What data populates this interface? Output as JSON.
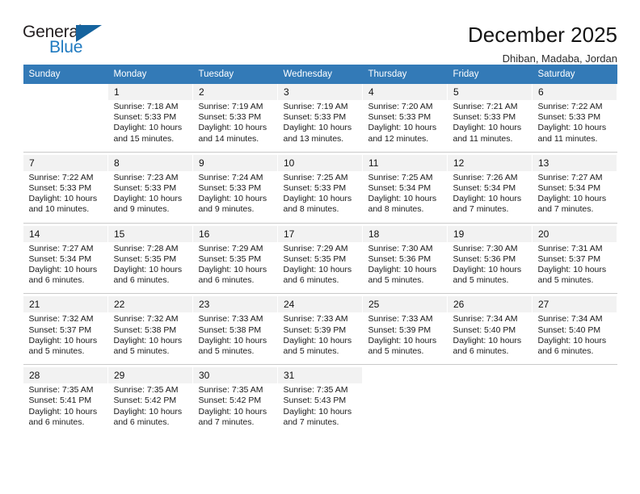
{
  "brand": {
    "name_top": "General",
    "name_bottom": "Blue",
    "accent_color": "#1f7ac0",
    "triangle_color": "#15639e"
  },
  "header": {
    "title": "December 2025",
    "location": "Dhiban, Madaba, Jordan"
  },
  "calendar": {
    "header_color": "#337ab7",
    "daynum_background": "#f2f2f2",
    "weekdays": [
      "Sunday",
      "Monday",
      "Tuesday",
      "Wednesday",
      "Thursday",
      "Friday",
      "Saturday"
    ],
    "weeks": [
      [
        {
          "day": "",
          "sunrise": "",
          "sunset": "",
          "daylight_1": "",
          "daylight_2": ""
        },
        {
          "day": "1",
          "sunrise": "Sunrise: 7:18 AM",
          "sunset": "Sunset: 5:33 PM",
          "daylight_1": "Daylight: 10 hours",
          "daylight_2": "and 15 minutes."
        },
        {
          "day": "2",
          "sunrise": "Sunrise: 7:19 AM",
          "sunset": "Sunset: 5:33 PM",
          "daylight_1": "Daylight: 10 hours",
          "daylight_2": "and 14 minutes."
        },
        {
          "day": "3",
          "sunrise": "Sunrise: 7:19 AM",
          "sunset": "Sunset: 5:33 PM",
          "daylight_1": "Daylight: 10 hours",
          "daylight_2": "and 13 minutes."
        },
        {
          "day": "4",
          "sunrise": "Sunrise: 7:20 AM",
          "sunset": "Sunset: 5:33 PM",
          "daylight_1": "Daylight: 10 hours",
          "daylight_2": "and 12 minutes."
        },
        {
          "day": "5",
          "sunrise": "Sunrise: 7:21 AM",
          "sunset": "Sunset: 5:33 PM",
          "daylight_1": "Daylight: 10 hours",
          "daylight_2": "and 11 minutes."
        },
        {
          "day": "6",
          "sunrise": "Sunrise: 7:22 AM",
          "sunset": "Sunset: 5:33 PM",
          "daylight_1": "Daylight: 10 hours",
          "daylight_2": "and 11 minutes."
        }
      ],
      [
        {
          "day": "7",
          "sunrise": "Sunrise: 7:22 AM",
          "sunset": "Sunset: 5:33 PM",
          "daylight_1": "Daylight: 10 hours",
          "daylight_2": "and 10 minutes."
        },
        {
          "day": "8",
          "sunrise": "Sunrise: 7:23 AM",
          "sunset": "Sunset: 5:33 PM",
          "daylight_1": "Daylight: 10 hours",
          "daylight_2": "and 9 minutes."
        },
        {
          "day": "9",
          "sunrise": "Sunrise: 7:24 AM",
          "sunset": "Sunset: 5:33 PM",
          "daylight_1": "Daylight: 10 hours",
          "daylight_2": "and 9 minutes."
        },
        {
          "day": "10",
          "sunrise": "Sunrise: 7:25 AM",
          "sunset": "Sunset: 5:33 PM",
          "daylight_1": "Daylight: 10 hours",
          "daylight_2": "and 8 minutes."
        },
        {
          "day": "11",
          "sunrise": "Sunrise: 7:25 AM",
          "sunset": "Sunset: 5:34 PM",
          "daylight_1": "Daylight: 10 hours",
          "daylight_2": "and 8 minutes."
        },
        {
          "day": "12",
          "sunrise": "Sunrise: 7:26 AM",
          "sunset": "Sunset: 5:34 PM",
          "daylight_1": "Daylight: 10 hours",
          "daylight_2": "and 7 minutes."
        },
        {
          "day": "13",
          "sunrise": "Sunrise: 7:27 AM",
          "sunset": "Sunset: 5:34 PM",
          "daylight_1": "Daylight: 10 hours",
          "daylight_2": "and 7 minutes."
        }
      ],
      [
        {
          "day": "14",
          "sunrise": "Sunrise: 7:27 AM",
          "sunset": "Sunset: 5:34 PM",
          "daylight_1": "Daylight: 10 hours",
          "daylight_2": "and 6 minutes."
        },
        {
          "day": "15",
          "sunrise": "Sunrise: 7:28 AM",
          "sunset": "Sunset: 5:35 PM",
          "daylight_1": "Daylight: 10 hours",
          "daylight_2": "and 6 minutes."
        },
        {
          "day": "16",
          "sunrise": "Sunrise: 7:29 AM",
          "sunset": "Sunset: 5:35 PM",
          "daylight_1": "Daylight: 10 hours",
          "daylight_2": "and 6 minutes."
        },
        {
          "day": "17",
          "sunrise": "Sunrise: 7:29 AM",
          "sunset": "Sunset: 5:35 PM",
          "daylight_1": "Daylight: 10 hours",
          "daylight_2": "and 6 minutes."
        },
        {
          "day": "18",
          "sunrise": "Sunrise: 7:30 AM",
          "sunset": "Sunset: 5:36 PM",
          "daylight_1": "Daylight: 10 hours",
          "daylight_2": "and 5 minutes."
        },
        {
          "day": "19",
          "sunrise": "Sunrise: 7:30 AM",
          "sunset": "Sunset: 5:36 PM",
          "daylight_1": "Daylight: 10 hours",
          "daylight_2": "and 5 minutes."
        },
        {
          "day": "20",
          "sunrise": "Sunrise: 7:31 AM",
          "sunset": "Sunset: 5:37 PM",
          "daylight_1": "Daylight: 10 hours",
          "daylight_2": "and 5 minutes."
        }
      ],
      [
        {
          "day": "21",
          "sunrise": "Sunrise: 7:32 AM",
          "sunset": "Sunset: 5:37 PM",
          "daylight_1": "Daylight: 10 hours",
          "daylight_2": "and 5 minutes."
        },
        {
          "day": "22",
          "sunrise": "Sunrise: 7:32 AM",
          "sunset": "Sunset: 5:38 PM",
          "daylight_1": "Daylight: 10 hours",
          "daylight_2": "and 5 minutes."
        },
        {
          "day": "23",
          "sunrise": "Sunrise: 7:33 AM",
          "sunset": "Sunset: 5:38 PM",
          "daylight_1": "Daylight: 10 hours",
          "daylight_2": "and 5 minutes."
        },
        {
          "day": "24",
          "sunrise": "Sunrise: 7:33 AM",
          "sunset": "Sunset: 5:39 PM",
          "daylight_1": "Daylight: 10 hours",
          "daylight_2": "and 5 minutes."
        },
        {
          "day": "25",
          "sunrise": "Sunrise: 7:33 AM",
          "sunset": "Sunset: 5:39 PM",
          "daylight_1": "Daylight: 10 hours",
          "daylight_2": "and 5 minutes."
        },
        {
          "day": "26",
          "sunrise": "Sunrise: 7:34 AM",
          "sunset": "Sunset: 5:40 PM",
          "daylight_1": "Daylight: 10 hours",
          "daylight_2": "and 6 minutes."
        },
        {
          "day": "27",
          "sunrise": "Sunrise: 7:34 AM",
          "sunset": "Sunset: 5:40 PM",
          "daylight_1": "Daylight: 10 hours",
          "daylight_2": "and 6 minutes."
        }
      ],
      [
        {
          "day": "28",
          "sunrise": "Sunrise: 7:35 AM",
          "sunset": "Sunset: 5:41 PM",
          "daylight_1": "Daylight: 10 hours",
          "daylight_2": "and 6 minutes."
        },
        {
          "day": "29",
          "sunrise": "Sunrise: 7:35 AM",
          "sunset": "Sunset: 5:42 PM",
          "daylight_1": "Daylight: 10 hours",
          "daylight_2": "and 6 minutes."
        },
        {
          "day": "30",
          "sunrise": "Sunrise: 7:35 AM",
          "sunset": "Sunset: 5:42 PM",
          "daylight_1": "Daylight: 10 hours",
          "daylight_2": "and 7 minutes."
        },
        {
          "day": "31",
          "sunrise": "Sunrise: 7:35 AM",
          "sunset": "Sunset: 5:43 PM",
          "daylight_1": "Daylight: 10 hours",
          "daylight_2": "and 7 minutes."
        },
        {
          "day": "",
          "sunrise": "",
          "sunset": "",
          "daylight_1": "",
          "daylight_2": ""
        },
        {
          "day": "",
          "sunrise": "",
          "sunset": "",
          "daylight_1": "",
          "daylight_2": ""
        },
        {
          "day": "",
          "sunrise": "",
          "sunset": "",
          "daylight_1": "",
          "daylight_2": ""
        }
      ]
    ]
  }
}
